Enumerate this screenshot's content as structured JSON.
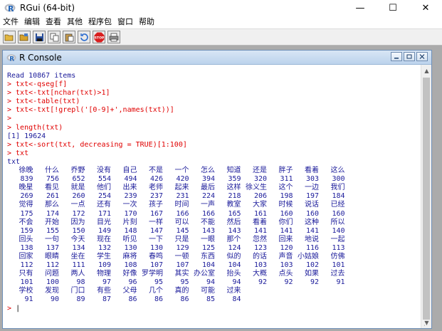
{
  "window": {
    "title": "RGui (64-bit)",
    "minimize": "—",
    "maximize": "☐",
    "close": "✕"
  },
  "menu": [
    "文件",
    "编辑",
    "查看",
    "其他",
    "程序包",
    "窗口",
    "帮助"
  ],
  "toolbar": {
    "icons": [
      "open-script-icon",
      "load-workspace-icon",
      "save-workspace-icon",
      "copy-icon",
      "paste-icon",
      "copy-paste-icon",
      "stop-icon",
      "print-icon"
    ],
    "stop_label": "STOP"
  },
  "console": {
    "title": "R Console",
    "lines": [
      {
        "t": "out",
        "text": "Read 10867 items"
      },
      {
        "t": "cmd",
        "text": "> txt<-qseg[f]"
      },
      {
        "t": "cmd",
        "text": "> txt<-txt[nchar(txt)>1]"
      },
      {
        "t": "cmd",
        "text": "> txt<-table(txt)"
      },
      {
        "t": "cmd",
        "text": "> txt<-txt[!grepl('[0-9]+',names(txt))]"
      },
      {
        "t": "cmd",
        "text": ">"
      },
      {
        "t": "cmd",
        "text": "> length(txt)"
      },
      {
        "t": "out",
        "text": "[1] 19624"
      },
      {
        "t": "cmd",
        "text": "> txt<-sort(txt, decreasing = TRUE)[1:100]"
      },
      {
        "t": "cmd",
        "text": "> txt"
      },
      {
        "t": "out",
        "text": "txt"
      }
    ],
    "table": [
      {
        "words": [
          "徐晚",
          "什么",
          "乔野",
          "没有",
          "自己",
          "不是",
          "一个",
          "怎么",
          "知道",
          "还是",
          "胖子",
          "看着",
          "这么"
        ],
        "counts": [
          "839",
          "756",
          "652",
          "554",
          "494",
          "426",
          "420",
          "394",
          "359",
          "320",
          "311",
          "303",
          "300"
        ]
      },
      {
        "words": [
          "晚星",
          "看见",
          "就是",
          "他们",
          "出来",
          "老师",
          "起来",
          "最后",
          "这样",
          "徐义生",
          "这个",
          "一边",
          "我们"
        ],
        "counts": [
          "269",
          "261",
          "260",
          "254",
          "239",
          "237",
          "231",
          "224",
          "218",
          "206",
          "198",
          "197",
          "184"
        ]
      },
      {
        "words": [
          "觉得",
          "那么",
          "一点",
          "还有",
          "一次",
          "孩子",
          "时间",
          "一声",
          "教室",
          "大家",
          "时候",
          "说话",
          "已经"
        ],
        "counts": [
          "175",
          "174",
          "172",
          "171",
          "170",
          "167",
          "166",
          "166",
          "165",
          "161",
          "160",
          "160",
          "160"
        ]
      },
      {
        "words": [
          "不会",
          "开始",
          "因为",
          "目光",
          "片刻",
          "一样",
          "可以",
          "不能",
          "然后",
          "看着",
          "你们",
          "这种",
          "所以"
        ],
        "counts": [
          "159",
          "155",
          "150",
          "149",
          "148",
          "147",
          "145",
          "143",
          "143",
          "141",
          "141",
          "141",
          "140"
        ]
      },
      {
        "words": [
          "回头",
          "一句",
          "今天",
          "现在",
          "听见",
          "一下",
          "只是",
          "一眼",
          "那个",
          "忽然",
          "回来",
          "地说",
          "一起"
        ],
        "counts": [
          "138",
          "137",
          "134",
          "132",
          "130",
          "130",
          "129",
          "125",
          "124",
          "123",
          "120",
          "116",
          "113"
        ]
      },
      {
        "words": [
          "回家",
          "眼睛",
          "坐在",
          "学生",
          "麻将",
          "春鸣",
          "一顿",
          "东西",
          "似的",
          "的话",
          "声音",
          "小姑娘",
          "仿佛"
        ],
        "counts": [
          "112",
          "112",
          "111",
          "109",
          "108",
          "107",
          "107",
          "104",
          "104",
          "103",
          "103",
          "102",
          "101"
        ]
      },
      {
        "words": [
          "只有",
          "问题",
          "两人",
          "物理",
          "好像",
          "罗学明",
          "其实",
          "办公室",
          "抬头",
          "大概",
          "点头",
          "如果",
          "过去"
        ],
        "counts": [
          "101",
          "100",
          "98",
          "97",
          "96",
          "95",
          "95",
          "94",
          "94",
          "92",
          "92",
          "92",
          "91"
        ]
      },
      {
        "words": [
          "学校",
          "发现",
          "门口",
          "有些",
          "父母",
          "几个",
          "真的",
          "可能",
          "过来",
          "",
          "",
          "",
          ""
        ],
        "counts": [
          "91",
          "90",
          "89",
          "87",
          "86",
          "86",
          "86",
          "85",
          "84",
          "",
          "",
          "",
          ""
        ]
      }
    ],
    "prompt": ">",
    "caret": "|"
  }
}
